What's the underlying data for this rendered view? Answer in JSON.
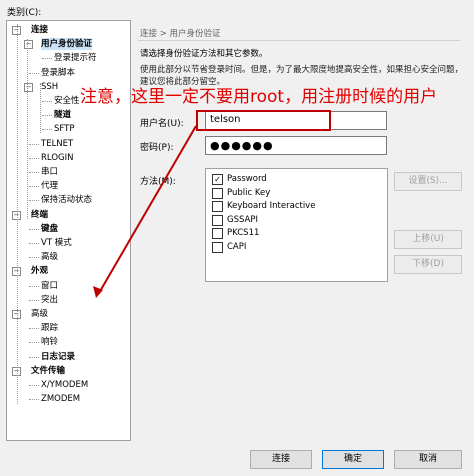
{
  "category_label": "类别(C):",
  "tree": [
    {
      "label": "连接",
      "level": 0,
      "bold": true,
      "toggle": "−"
    },
    {
      "label": "用户身份验证",
      "level": 1,
      "bold": true,
      "toggle": "−",
      "selected": true
    },
    {
      "label": "登录提示符",
      "level": 2,
      "bold": false
    },
    {
      "label": "登录脚本",
      "level": 1,
      "bold": false
    },
    {
      "label": "SSH",
      "level": 1,
      "bold": false,
      "toggle": "−"
    },
    {
      "label": "安全性",
      "level": 2,
      "bold": false
    },
    {
      "label": "隧道",
      "level": 2,
      "bold": true
    },
    {
      "label": "SFTP",
      "level": 2,
      "bold": false
    },
    {
      "label": "TELNET",
      "level": 1,
      "bold": false
    },
    {
      "label": "RLOGIN",
      "level": 1,
      "bold": false
    },
    {
      "label": "串口",
      "level": 1,
      "bold": false
    },
    {
      "label": "代理",
      "level": 1,
      "bold": false
    },
    {
      "label": "保持活动状态",
      "level": 1,
      "bold": false
    },
    {
      "label": "终端",
      "level": 0,
      "bold": true,
      "toggle": "−"
    },
    {
      "label": "键盘",
      "level": 1,
      "bold": true
    },
    {
      "label": "VT 模式",
      "level": 1,
      "bold": false
    },
    {
      "label": "高级",
      "level": 1,
      "bold": false
    },
    {
      "label": "外观",
      "level": 0,
      "bold": true,
      "toggle": "−"
    },
    {
      "label": "窗口",
      "level": 1,
      "bold": false
    },
    {
      "label": "突出",
      "level": 1,
      "bold": false
    },
    {
      "label": "高级",
      "level": 0,
      "bold": false,
      "toggle": "−"
    },
    {
      "label": "跟踪",
      "level": 1,
      "bold": false
    },
    {
      "label": "响铃",
      "level": 1,
      "bold": false
    },
    {
      "label": "日志记录",
      "level": 1,
      "bold": true
    },
    {
      "label": "文件传输",
      "level": 0,
      "bold": true,
      "toggle": "−"
    },
    {
      "label": "X/YMODEM",
      "level": 1,
      "bold": false
    },
    {
      "label": "ZMODEM",
      "level": 1,
      "bold": false
    }
  ],
  "breadcrumb": "连接 > 用户身份验证",
  "description_line1": "请选择身份验证方法和其它参数。",
  "description_line2": "使用此部分以节省登录时间。但是，为了最大限度地提高安全性，如果担心安全问题，建议您将此部分留空。",
  "username_label": "用户名(U):",
  "username_value": "telson",
  "password_label": "密码(P):",
  "password_mask": "●●●●●●",
  "method_label": "方法(M):",
  "methods": [
    {
      "label": "Password",
      "checked": true
    },
    {
      "label": "Public Key",
      "checked": false
    },
    {
      "label": "Keyboard Interactive",
      "checked": false
    },
    {
      "label": "GSSAPI",
      "checked": false
    },
    {
      "label": "PKCS11",
      "checked": false
    },
    {
      "label": "CAPI",
      "checked": false
    }
  ],
  "buttons": {
    "settings": "设置(S)...",
    "move_up": "上移(U)",
    "move_down": "下移(D)",
    "connect": "连接",
    "ok": "确定",
    "cancel": "取消"
  },
  "annotation": "注意，这里一定不要用root，用注册时候的用户",
  "colors": {
    "annotation": "#e00000",
    "highlight_box": "#c00000",
    "selection": "#cce4f7"
  }
}
